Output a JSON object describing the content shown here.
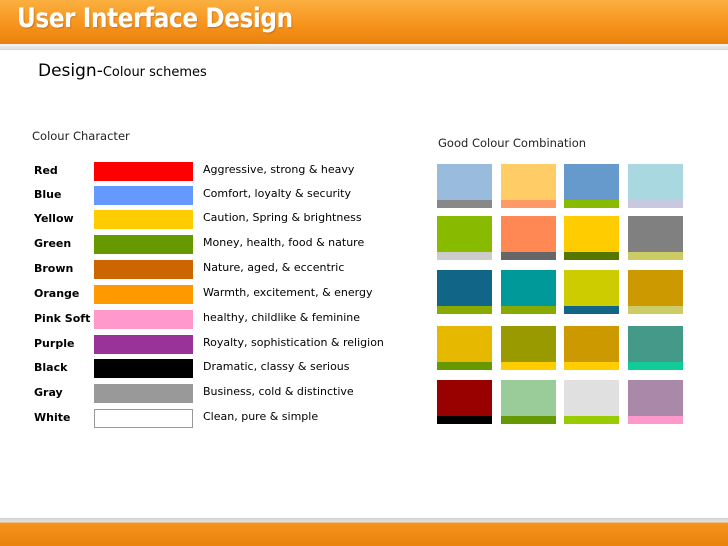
{
  "header": {
    "title": "User Interface Design"
  },
  "subtitle": {
    "main": "Design-",
    "sub": "Colour schemes"
  },
  "character_section": {
    "label": "Colour Character"
  },
  "combination_section": {
    "label": "Good Colour Combination"
  },
  "colour_characters": [
    {
      "name": "Red",
      "color": "#ff0000",
      "description": "Aggressive, strong & heavy"
    },
    {
      "name": "Blue",
      "color": "#6699ff",
      "description": "Comfort, loyalty & security"
    },
    {
      "name": "Yellow",
      "color": "#ffcc00",
      "description": "Caution, Spring & brightness"
    },
    {
      "name": "Green",
      "color": "#669900",
      "description": "Money, health, food & nature"
    },
    {
      "name": "Brown",
      "color": "#cc6600",
      "description": "Nature, aged, & eccentric"
    },
    {
      "name": "Orange",
      "color": "#ff9900",
      "description": "Warmth, excitement, & energy"
    },
    {
      "name": "Pink Soft",
      "color": "#ff99cc",
      "description": "healthy, childlike & feminine"
    },
    {
      "name": "Purple",
      "color": "#993399",
      "description": "Royalty, sophistication & religion"
    },
    {
      "name": "Black",
      "color": "#000000",
      "description": "Dramatic, classy & serious"
    },
    {
      "name": "Gray",
      "color": "#999999",
      "description": "Business, cold & distinctive"
    },
    {
      "name": "White",
      "color": "#ffffff",
      "description": "Clean, pure & simple"
    }
  ],
  "combinations": [
    [
      {
        "main": "#99bbdd",
        "accent": "#888888"
      },
      {
        "main": "#ffcc66",
        "accent": "#ff9966"
      },
      {
        "main": "#6699cc",
        "accent": "#88bb00"
      },
      {
        "main": "#aad8e0",
        "accent": "#c8c8e0"
      }
    ],
    [
      {
        "main": "#88bb00",
        "accent": "#cccccc"
      },
      {
        "main": "#ff8855",
        "accent": "#666666"
      },
      {
        "main": "#ffcc00",
        "accent": "#557700"
      },
      {
        "main": "#808080",
        "accent": "#cccc66"
      }
    ],
    [
      {
        "main": "#116688",
        "accent": "#88aa00"
      },
      {
        "main": "#009999",
        "accent": "#88aa00"
      },
      {
        "main": "#cccc00",
        "accent": "#116688"
      },
      {
        "main": "#cc9900",
        "accent": "#cccc66"
      }
    ],
    [
      {
        "main": "#e6b800",
        "accent": "#669900"
      },
      {
        "main": "#999900",
        "accent": "#ffcc00"
      },
      {
        "main": "#cc9900",
        "accent": "#ffcc00"
      },
      {
        "main": "#449988",
        "accent": "#11cc99"
      }
    ],
    [
      {
        "main": "#990000",
        "accent": "#000000"
      },
      {
        "main": "#99cc99",
        "accent": "#669900"
      },
      {
        "main": "#e0e0e0",
        "accent": "#99cc00"
      },
      {
        "main": "#aa88aa",
        "accent": "#ff99cc"
      }
    ]
  ]
}
